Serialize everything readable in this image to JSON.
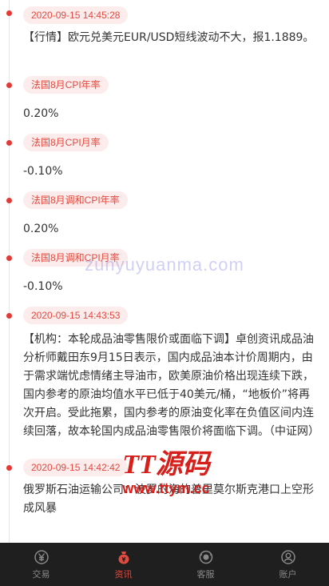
{
  "feed": [
    {
      "tag": "2020-09-15 14:45:28",
      "text": "【行情】欧元兑美元EUR/USD短线波动不大，报1.1889。"
    },
    {
      "tag": "法国8月CPI年率",
      "text": "0.20%"
    },
    {
      "tag": "法国8月CPI月率",
      "text": "-0.10%"
    },
    {
      "tag": "法国8月调和CPI年率",
      "text": "0.20%"
    },
    {
      "tag": "法国8月调和CPI月率",
      "text": "-0.10%"
    },
    {
      "tag": "2020-09-15 14:43:53",
      "text": "【机构：本轮成品油零售限价或面临下调】卓创资讯成品油分析师戴田东9月15日表示，国内成品油本计价周期内，由于需求端忧虑情绪主导油市，欧美原油价格出现连续下跌，国内参考的原油均值水平已低于40美元/桶，“地板价”将再次开启。受此拖累，国内参考的原油变化率在负值区间内连续回落，故本轮国内成品油零售限价将面临下调。（中证网）"
    },
    {
      "tag": "2020-09-15 14:42:42",
      "text": "俄罗斯石油运输公司：波罗的海的普里莫尔斯克港口上空形成风暴"
    }
  ],
  "watermarks": {
    "mid": "zunyuyuanma.com",
    "logo_title": "TT源码",
    "logo_url": "www.ttym.cc"
  },
  "tabbar": {
    "active": 1,
    "items": [
      {
        "label": "交易",
        "icon": "yen-circle-icon"
      },
      {
        "label": "资讯",
        "icon": "news-bag-icon"
      },
      {
        "label": "客服",
        "icon": "customer-service-icon"
      },
      {
        "label": "账户",
        "icon": "user-icon"
      }
    ]
  },
  "colors": {
    "accent": "#e04a3f",
    "tag_bg": "#fdecec",
    "tabbar_bg": "#1f1f1f"
  }
}
